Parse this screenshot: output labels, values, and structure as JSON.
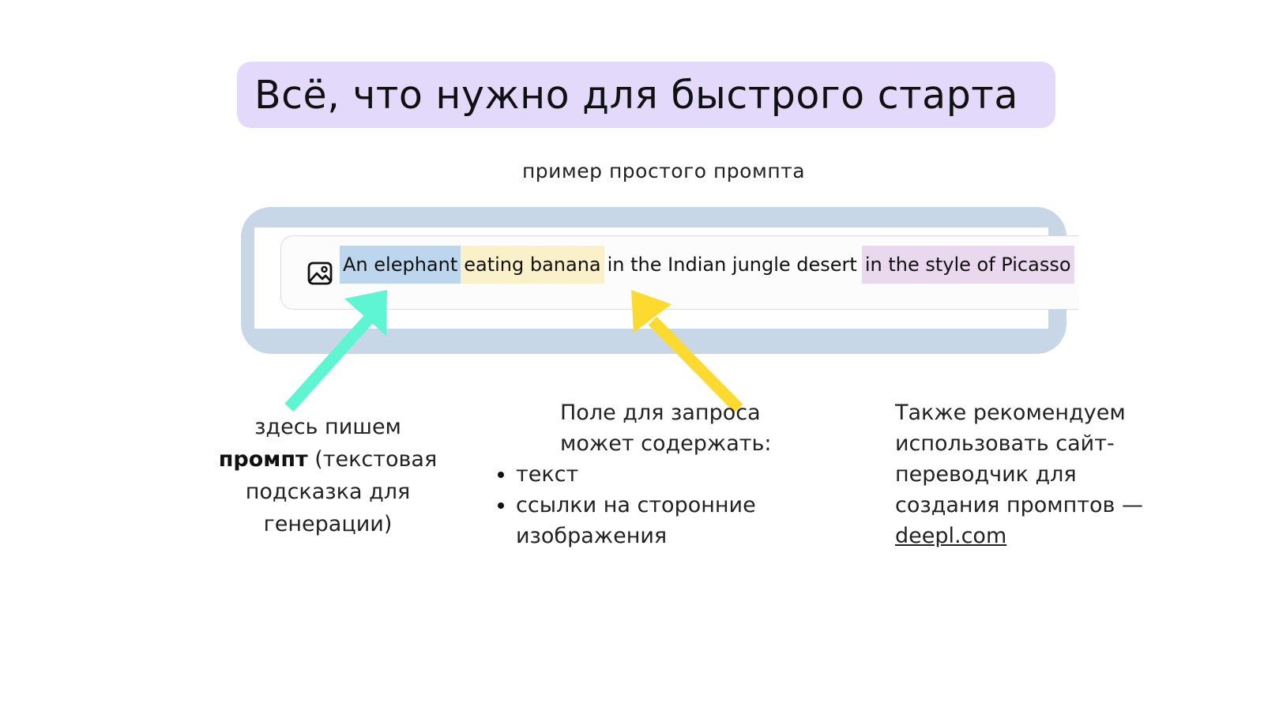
{
  "title": "Всё, что нужно для быстрого старта",
  "subtitle": "пример простого промпта",
  "prompt_bar": {
    "icon": "image-icon",
    "segments": [
      {
        "text": "An elephant",
        "highlight": "#bcd6ee"
      },
      {
        "text": "eating banana",
        "highlight": "#fbf1c8"
      },
      {
        "text": "in the Indian jungle desert",
        "highlight": "none"
      },
      {
        "text": "in the style of Picasso",
        "highlight": "#ead8ee"
      }
    ]
  },
  "arrows": {
    "left_color": "#5ef5d2",
    "middle_color": "#fddb2e"
  },
  "captions": {
    "left": {
      "line1": "здесь пишем",
      "bold": "промпт",
      "rest": "(текстовая подсказка для генерации)"
    },
    "middle": {
      "lead_line1": "Поле для запроса",
      "lead_line2": "может содержать:",
      "bullets": [
        "текст",
        "ссылки на сторонние изображения"
      ]
    },
    "right": {
      "text": "Также рекомендуем использовать сайт-переводчик для создания промптов —",
      "link": "deepl.com"
    }
  },
  "colors": {
    "title_bg": "#e3d9fb",
    "frame": "#c8d7e7"
  }
}
